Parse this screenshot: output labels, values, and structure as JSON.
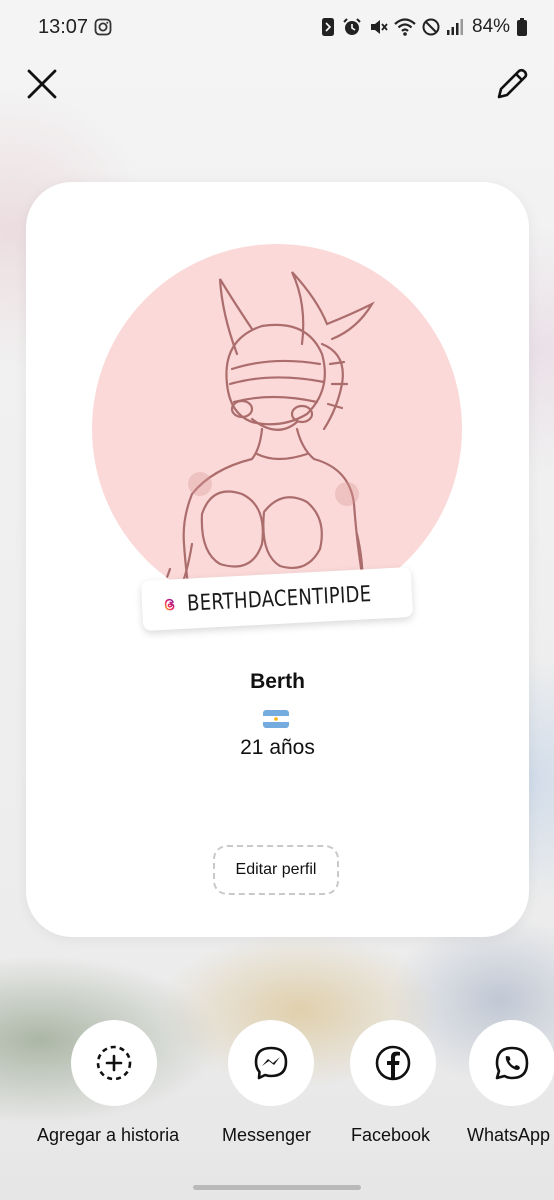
{
  "status_bar": {
    "time": "13:07",
    "battery": "84%",
    "icons": [
      "instagram-icon",
      "nfc-icon",
      "alarm-icon",
      "mute-icon",
      "wifi-icon",
      "do-not-disturb-icon",
      "signal-icon",
      "battery-icon"
    ]
  },
  "header": {
    "close_icon": "close-icon",
    "edit_icon": "pencil-icon"
  },
  "profile_card": {
    "username": "BERTHDACENTIPIDE",
    "display_name": "Berth",
    "flag": "🇦🇷",
    "bio": "21 años",
    "edit_button_label": "Editar perfil",
    "avatar_color": "#fbd9d9"
  },
  "share_targets": [
    {
      "label": "Agregar a historia",
      "icon": "add-story-icon"
    },
    {
      "label": "Messenger",
      "icon": "messenger-icon"
    },
    {
      "label": "Facebook",
      "icon": "facebook-icon"
    },
    {
      "label": "WhatsApp",
      "icon": "whatsapp-icon"
    }
  ]
}
